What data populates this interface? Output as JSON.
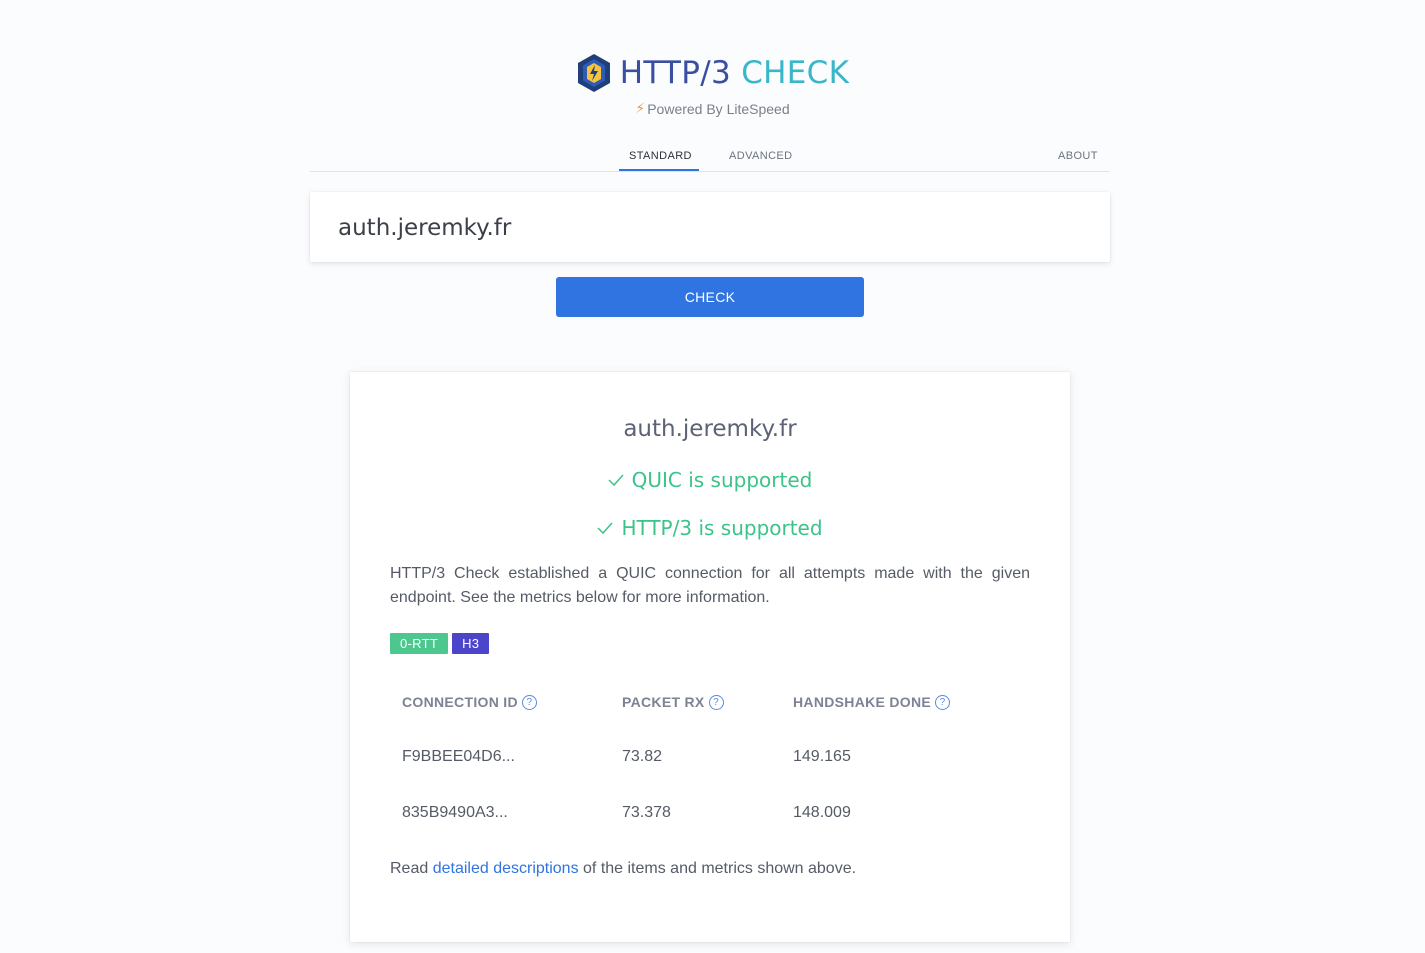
{
  "header": {
    "logo_part1": "HTTP/3",
    "logo_part2": "CHECK",
    "powered_bolt": "⚡",
    "powered": "Powered By LiteSpeed"
  },
  "tabs": [
    {
      "label": "STANDARD",
      "active": true
    },
    {
      "label": "ADVANCED",
      "active": false
    },
    {
      "label": "ABOUT",
      "active": false
    }
  ],
  "search": {
    "value": "auth.jeremky.fr",
    "button": "CHECK"
  },
  "result": {
    "domain": "auth.jeremky.fr",
    "quic": "QUIC is supported",
    "http3": "HTTP/3 is supported",
    "description": "HTTP/3 Check established a QUIC connection for all attempts made with the given endpoint. See the metrics below for more information.",
    "badges": [
      "0-RTT",
      "H3"
    ],
    "metrics": {
      "headers": [
        "CONNECTION ID",
        "PACKET RX",
        "HANDSHAKE DONE"
      ],
      "rows": [
        [
          "F9BBEE04D6...",
          "73.82",
          "149.165"
        ],
        [
          "835B9490A3...",
          "73.378",
          "148.009"
        ]
      ]
    },
    "read_prefix": "Read ",
    "read_link": "detailed descriptions",
    "read_suffix": " of the items and metrics shown above."
  },
  "colors": {
    "accent": "#2f74e0",
    "success": "#3cc38a",
    "badge_rtt": "#4cc88f",
    "badge_h3": "#4d45c9"
  },
  "icons": {
    "logo": "litespeed-logo-icon",
    "check": "check-icon",
    "help": "help-circle-icon"
  }
}
